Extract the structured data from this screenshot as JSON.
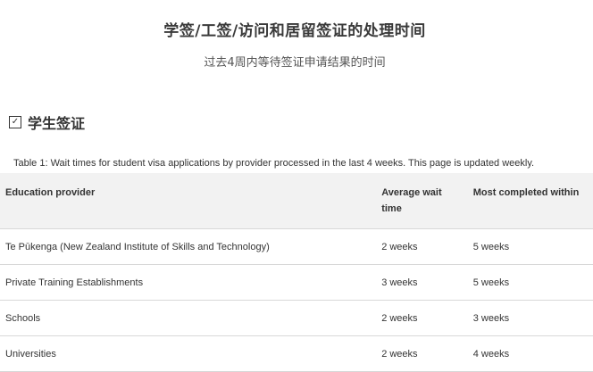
{
  "header": {
    "title": "学签/工签/访问和居留签证的处理时间",
    "subtitle": "过去4周内等待签证申请结果的时间"
  },
  "section": {
    "icon": "checkbox-icon",
    "heading": "学生签证"
  },
  "table": {
    "caption": "Table 1: Wait times for student visa applications by provider processed in the last 4 weeks. This page is updated weekly.",
    "headers": {
      "provider": "Education provider",
      "average": "Average wait time",
      "most": "Most completed within"
    },
    "rows": [
      {
        "provider": "Te Pūkenga (New Zealand Institute of Skills and Technology)",
        "average": "2 weeks",
        "most": "5 weeks"
      },
      {
        "provider": "Private Training Establishments",
        "average": "3 weeks",
        "most": "5 weeks"
      },
      {
        "provider": "Schools",
        "average": "2 weeks",
        "most": "3 weeks"
      },
      {
        "provider": "Universities",
        "average": "2 weeks",
        "most": "4 weeks"
      }
    ]
  }
}
